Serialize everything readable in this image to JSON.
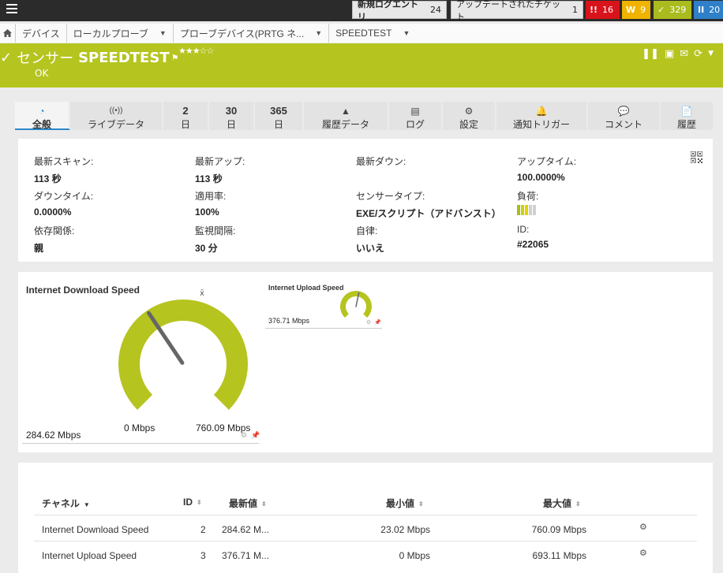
{
  "topbar": {
    "new_log_label": "新規ログエントリ",
    "new_log_count": "24",
    "updated_tickets_label": "アップデートされたチケット",
    "updated_tickets_count": "1",
    "badges": [
      {
        "symbol": "!!",
        "count": "16",
        "color": "#d9131b"
      },
      {
        "symbol": "W",
        "count": "9",
        "color": "#f0b400"
      },
      {
        "symbol": "✓",
        "count": "329",
        "color": "#aabb1e"
      },
      {
        "symbol": "II",
        "count": "20",
        "color": "#2f80c8"
      }
    ]
  },
  "breadcrumb": {
    "home_icon": "home-icon",
    "items": [
      "デバイス",
      "ローカルプローブ",
      "プローブデバイス(PRTG ネ...",
      "SPEEDTEST"
    ]
  },
  "header": {
    "prefix": "センサー",
    "name": "SPEEDTEST",
    "stars": "★★★☆☆",
    "status": "OK",
    "color": "#b5c41f"
  },
  "tabs": [
    {
      "icon": "◔",
      "label": "全般",
      "active": true
    },
    {
      "icon": "((•))",
      "label": "ライブデータ"
    },
    {
      "icon": "2",
      "label": "日"
    },
    {
      "icon": "30",
      "label": "日"
    },
    {
      "icon": "365",
      "label": "日"
    },
    {
      "icon": "▲",
      "label": "履歴データ"
    },
    {
      "icon": "▤",
      "label": "ログ"
    },
    {
      "icon": "⚙",
      "label": "設定"
    },
    {
      "icon": "🔔",
      "label": "通知トリガー"
    },
    {
      "icon": "💬",
      "label": "コメント"
    },
    {
      "icon": "📄",
      "label": "履歴"
    }
  ],
  "info": [
    {
      "key": "最新スキャン:",
      "value": "113 秒"
    },
    {
      "key": "最新アップ:",
      "value": "113 秒"
    },
    {
      "key": "最新ダウン:",
      "value": ""
    },
    {
      "key": "アップタイム:",
      "value": "100.0000%"
    },
    {
      "key": "ダウンタイム:",
      "value": "0.0000%"
    },
    {
      "key": "適用率:",
      "value": "100%"
    },
    {
      "key": "センサータイプ:",
      "value": "EXE/スクリプト（アドバンスト）"
    },
    {
      "key": "負荷:",
      "value": ""
    },
    {
      "key": "依存関係:",
      "value": "親"
    },
    {
      "key": "監視間隔:",
      "value": "30 分"
    },
    {
      "key": "自律:",
      "value": "いいえ"
    },
    {
      "key": "ID:",
      "value": "#22065"
    }
  ],
  "load_level": 0.5,
  "gauges": {
    "download": {
      "title": "Internet Download Speed",
      "value": 284.62,
      "value_label": "284.62 Mbps",
      "min_label": "0 Mbps",
      "max_label": "760.09 Mbps",
      "min": 0,
      "max": 760.09,
      "avg_mark": "x̄"
    },
    "upload": {
      "title": "Internet Upload Speed",
      "value": 376.71,
      "value_label": "376.71 Mbps",
      "min": 0,
      "max": 693.11
    }
  },
  "table": {
    "headers": [
      "チャネル",
      "ID",
      "最新値",
      "最小値",
      "最大値"
    ],
    "rows": [
      {
        "channel": "Internet Download Speed",
        "id": "2",
        "last": "284.62 M...",
        "min": "23.02 Mbps",
        "max": "760.09 Mbps"
      },
      {
        "channel": "Internet Upload Speed",
        "id": "3",
        "last": "376.71 M...",
        "min": "0 Mbps",
        "max": "693.11 Mbps"
      }
    ]
  }
}
